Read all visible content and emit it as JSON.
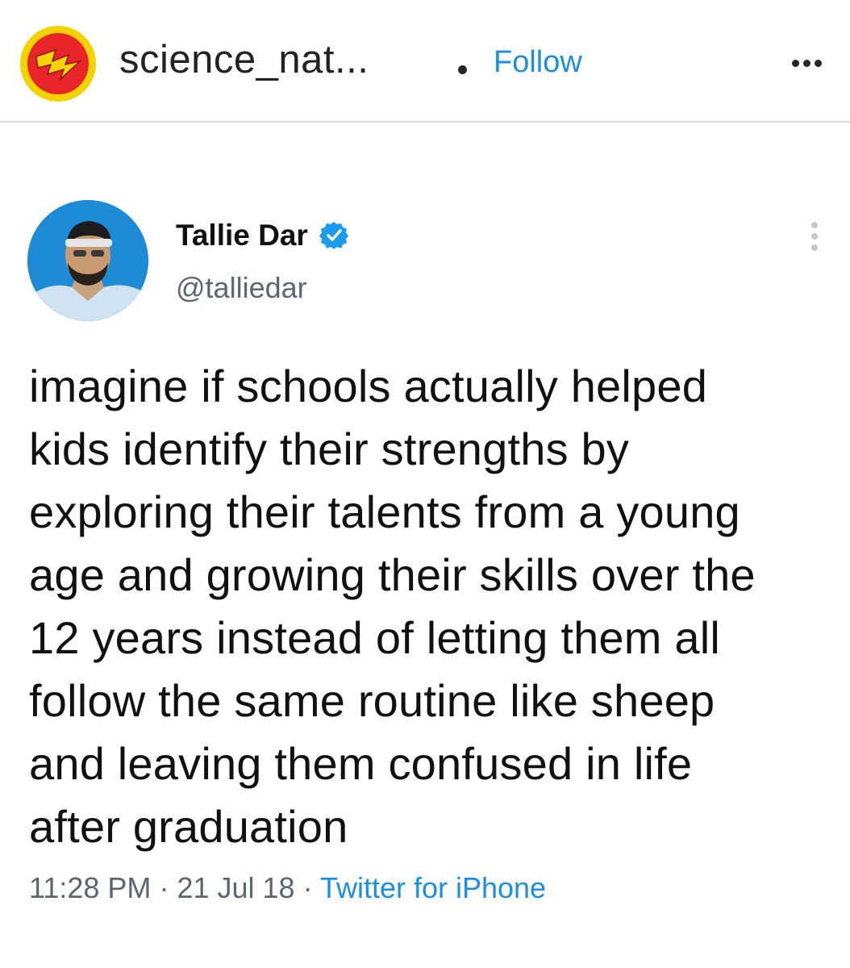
{
  "ig_header": {
    "avatar_icon": "lightning-bolt-logo",
    "username": "science_nat...",
    "follow_label": "Follow",
    "more_icon": "more-horizontal-icon"
  },
  "tweet": {
    "display_name": "Tallie Dar",
    "verified_icon": "verified-badge-icon",
    "handle": "@talliedar",
    "more_icon": "more-vertical-icon",
    "text": "imagine if schools actually helped\nkids identify their strengths  by\nexploring their talents from a young\nage and growing their skills over the\n12 years instead of letting them all\nfollow the same routine like sheep\nand leaving them confused in life\nafter graduation",
    "time": "11:28 PM",
    "date": "21 Jul 18",
    "source": "Twitter for iPhone",
    "separator": "·"
  },
  "colors": {
    "link_blue": "#1a8fe3",
    "verified_blue": "#1d9bf0",
    "muted_gray": "#5b6670",
    "logo_red": "#e8262a",
    "logo_yellow": "#f5d300"
  }
}
